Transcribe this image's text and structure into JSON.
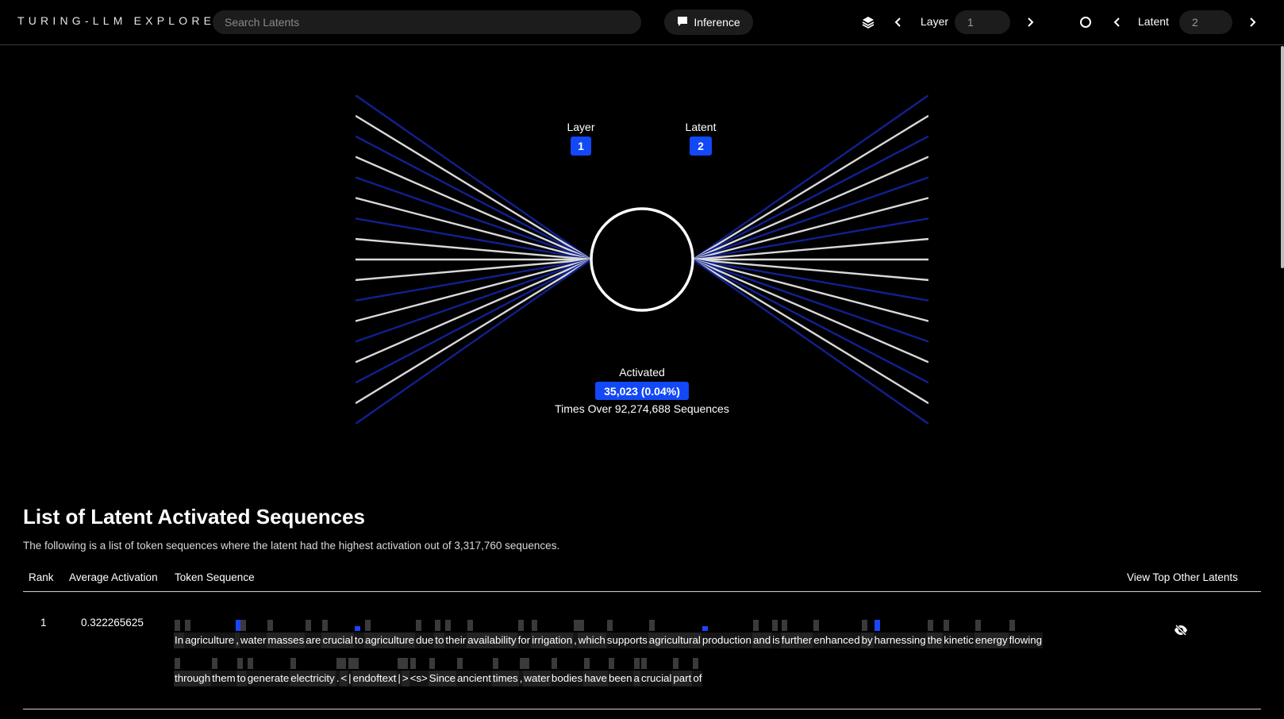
{
  "header": {
    "brand": "TURING-LLM EXPLORER",
    "search_placeholder": "Search Latents",
    "inference_label": "Inference",
    "layer_label": "Layer",
    "layer_value": "1",
    "latent_label": "Latent",
    "latent_value": "2",
    "icons": [
      "chat-bubble-icon",
      "layers-icon",
      "chevron-left-icon",
      "chevron-right-icon",
      "circle-icon"
    ]
  },
  "viz": {
    "layer_label": "Layer",
    "layer_value": "1",
    "latent_label": "Latent",
    "latent_value": "2",
    "activated_label": "Activated",
    "activated_value": "35,023 (0.04%)",
    "times_text": "Times Over 92,274,688 Sequences",
    "colors": {
      "blue_line": "#10218f",
      "white_line": "#d9d9d9",
      "badge": "#1248f5"
    }
  },
  "list": {
    "title": "List of Latent Activated Sequences",
    "description": "The following is a list of token sequences where the latent had the highest activation out of 3,317,760 sequences.",
    "columns": {
      "rank": "Rank",
      "avg": "Average Activation",
      "tokens": "Token Sequence",
      "other": "View Top Other Latents"
    },
    "rows": [
      {
        "rank": "1",
        "avg": "0.322265625",
        "line1": [
          "In",
          " agriculture",
          ",",
          " water",
          " masses",
          " are",
          " crucial",
          " to",
          " agriculture",
          " due",
          " to",
          " their",
          " availability",
          " for",
          " irrigation",
          ",",
          " which",
          " supports",
          " agricultural",
          " production",
          " and",
          " is",
          " further",
          " enhanced",
          " by",
          " harnessing",
          " the",
          " kinetic",
          " energy",
          " flowing"
        ],
        "line2": [
          " through",
          " them",
          " to",
          " generate",
          " electricity",
          ".",
          " <",
          "|",
          "endoftext",
          "|",
          ">",
          "<s>",
          " Since",
          " ancient",
          " times",
          ",",
          " water",
          " bodies",
          " have",
          " been",
          " a",
          " crucial",
          " part",
          " of"
        ],
        "line1_levels": [
          0,
          0,
          2,
          0,
          0,
          0,
          0,
          1,
          0,
          0,
          0,
          0,
          0,
          0,
          0,
          0,
          0,
          0,
          0,
          1,
          0,
          0,
          0,
          0,
          0,
          2,
          0,
          0,
          0,
          0
        ],
        "line2_levels": [
          0,
          0,
          0,
          0,
          0,
          0,
          0,
          0,
          0,
          0,
          0,
          0,
          0,
          0,
          0,
          0,
          0,
          0,
          0,
          0,
          0,
          0,
          0,
          0
        ],
        "other_icon": "eye-off-icon"
      }
    ]
  }
}
